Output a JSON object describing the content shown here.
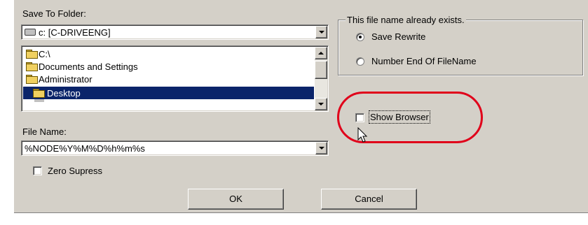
{
  "save_to_folder": {
    "label": "Save To Folder:",
    "drive_value": "c: [C-DRIVEENG]",
    "tree": [
      {
        "label": "C:\\",
        "level": 0,
        "selected": false
      },
      {
        "label": "Documents and Settings",
        "level": 1,
        "selected": false
      },
      {
        "label": "Administrator",
        "level": 1,
        "selected": false
      },
      {
        "label": "Desktop",
        "level": 2,
        "selected": true
      }
    ]
  },
  "exists_group": {
    "title": "This file name already exists.",
    "options": [
      {
        "label": "Save Rewrite",
        "selected": true
      },
      {
        "label": "Number End Of FileName",
        "selected": false
      }
    ]
  },
  "show_browser": {
    "label": "Show Browser",
    "checked": false
  },
  "file_name": {
    "label": "File Name:",
    "value": "%NODE%Y%M%D%h%m%s"
  },
  "zero_supress": {
    "label": "Zero Supress",
    "checked": false
  },
  "buttons": {
    "ok": "OK",
    "cancel": "Cancel"
  },
  "colors": {
    "dialog_bg": "#d4d0c8",
    "selection": "#0a246a",
    "highlight_ring": "#e0001a"
  },
  "icons": {
    "drive": "drive-icon",
    "folder": "folder-icon",
    "open_folder": "open-folder-icon",
    "cursor": "mouse-pointer-icon"
  }
}
